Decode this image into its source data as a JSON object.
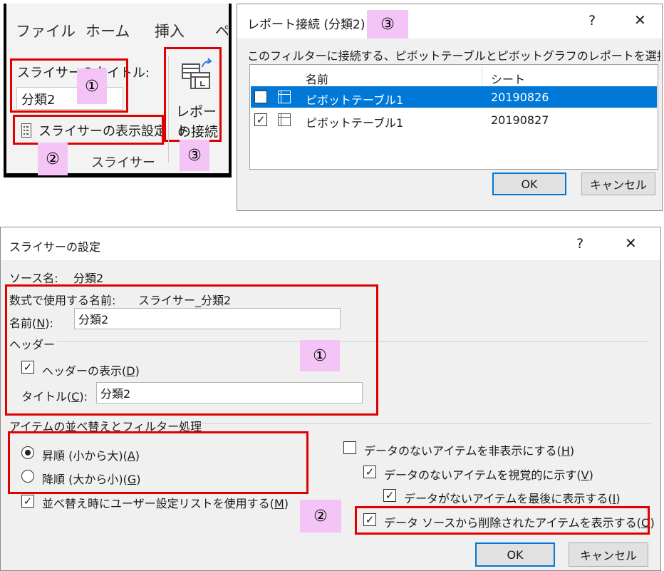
{
  "ribbon": {
    "tabs": [
      "ファイル",
      "ホーム",
      "挿入",
      "ペ"
    ],
    "title_label": "スライサーのタイトル:",
    "title_value": "分類2",
    "settings_label": "スライサーの表示設定",
    "report_line1": "レポート",
    "report_line2": "の接続",
    "group_label": "スライサー",
    "markers": [
      "①",
      "②",
      "③"
    ]
  },
  "report_dialog": {
    "title": "レポート接続 (分類2)",
    "marker": "③",
    "help": "?",
    "close": "✕",
    "instruction": "このフィルターに接続する、ピボットテーブルとピボットグラフのレポートを選択してください",
    "columns": [
      "名前",
      "シート"
    ],
    "rows": [
      {
        "name": "ピボットテーブル1",
        "sheet": "20190826",
        "checked": false,
        "selected": true
      },
      {
        "name": "ピボットテーブル1",
        "sheet": "20190827",
        "checked": true,
        "selected": false
      }
    ],
    "ok": "OK",
    "cancel": "キャンセル"
  },
  "settings_dialog": {
    "title": "スライサーの設定",
    "help": "?",
    "close": "✕",
    "source_label": "ソース名:",
    "source_value": "分類2",
    "formula_label": "数式で使用する名前:",
    "formula_value": "スライサー_分類2",
    "name_label": "名前(",
    "name_key": "N",
    "name_label_end": "):",
    "name_value": "分類2",
    "header_section": "ヘッダー",
    "show_header_label": "ヘッダーの表示(",
    "show_header_key": "D",
    "show_header_end": ")",
    "title_label": "タイトル(",
    "title_key": "C",
    "title_label_end": "):",
    "title_value": "分類2",
    "sort_section": "アイテムの並べ替えとフィルター処理",
    "asc_label": "昇順 (小から大)(",
    "asc_key": "A",
    "asc_end": ")",
    "desc_label": "降順 (大から小)(",
    "desc_key": "G",
    "desc_end": ")",
    "custom_list_label": "並べ替え時にユーザー設定リストを使用する(",
    "custom_list_key": "M",
    "custom_list_end": ")",
    "hide_no_data_label": "データのないアイテムを非表示にする(",
    "hide_no_data_key": "H",
    "hide_no_data_end": ")",
    "visual_no_data_label": "データのないアイテムを視覚的に示す(",
    "visual_no_data_key": "V",
    "visual_no_data_end": ")",
    "last_no_data_label": "データがないアイテムを最後に表示する(",
    "last_no_data_key": "I",
    "last_no_data_end": ")",
    "deleted_items_label": "データ ソースから削除されたアイテムを表示する(",
    "deleted_items_key": "O",
    "deleted_items_end": ")",
    "ok": "OK",
    "cancel": "キャンセル",
    "markers": [
      "①",
      "②"
    ]
  }
}
